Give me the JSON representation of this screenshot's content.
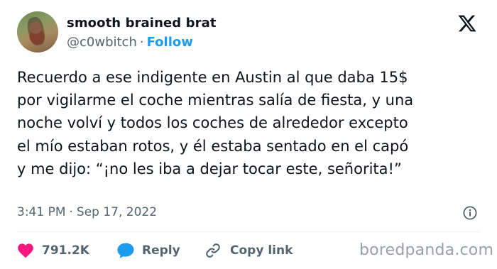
{
  "author": {
    "display_name": "smooth brained brat",
    "handle": "@c0wbitch",
    "separator": "·",
    "follow_label": "Follow"
  },
  "tweet": {
    "lines": [
      "Recuerdo a ese indigente en Austin al que daba 15$",
      "por vigilarme el coche mientras salía de fiesta, y una",
      "noche volví y todos los coches de alrededor excepto",
      "el mío estaban rotos, y él estaba sentado en el capó",
      "y me dijo: “¡no les iba a dejar tocar este, señorita!”"
    ],
    "time": "3:41 PM",
    "date_separator": "·",
    "date": "Sep 17, 2022"
  },
  "actions": {
    "likes": "791.2K",
    "reply_label": "Reply",
    "copy_link_label": "Copy link"
  },
  "icons": {
    "logo": "x-logo-icon",
    "info": "info-icon",
    "like": "heart-icon",
    "reply": "reply-bubble-icon",
    "copy": "link-icon"
  },
  "colors": {
    "accent": "#1d9bf0",
    "heart": "#f91880",
    "secondary_text": "#536471",
    "text": "#0f1419"
  },
  "watermark": "boredpanda.com"
}
